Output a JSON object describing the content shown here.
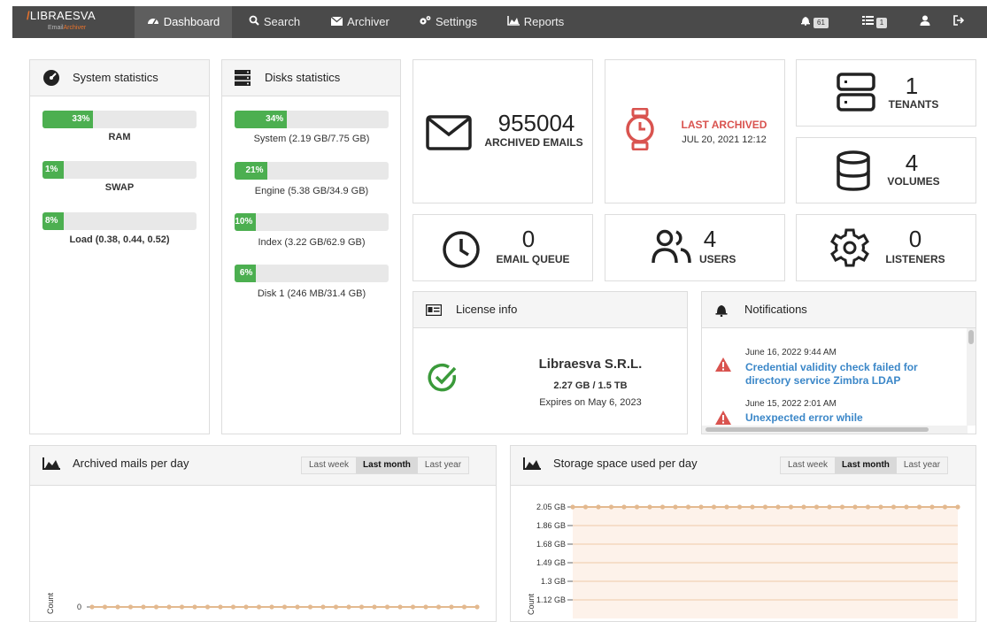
{
  "colors": {
    "accent_green": "#4caf50",
    "link_blue": "#3b87c8",
    "alert_red": "#d9534f",
    "brand_orange": "#e8722b",
    "chart_line": "#e3b98f",
    "chart_area": "#fdf2ea"
  },
  "brand": {
    "name": "LIBRAESVA",
    "sub_left": "Email",
    "sub_right": "Archiver"
  },
  "nav": {
    "items": [
      {
        "label": "Dashboard",
        "icon": "dashboard-icon"
      },
      {
        "label": "Search",
        "icon": "search-icon"
      },
      {
        "label": "Archiver",
        "icon": "envelope-icon"
      },
      {
        "label": "Settings",
        "icon": "gears-icon"
      },
      {
        "label": "Reports",
        "icon": "area-chart-icon"
      }
    ],
    "notifications_count": "61",
    "tasks_count": "1"
  },
  "system_stats": {
    "title": "System statistics",
    "bars": [
      {
        "pct_text": "33%",
        "fill": 0.33,
        "label": "RAM"
      },
      {
        "pct_text": "1%",
        "fill": 0.01,
        "label": "SWAP"
      },
      {
        "pct_text": "8%",
        "fill": 0.08,
        "label": "Load (0.38, 0.44, 0.52)"
      }
    ]
  },
  "disk_stats": {
    "title": "Disks statistics",
    "bars": [
      {
        "pct_text": "34%",
        "fill": 0.34,
        "label": "System (2.19 GB/7.75 GB)"
      },
      {
        "pct_text": "21%",
        "fill": 0.21,
        "label": "Engine (5.38 GB/34.9 GB)"
      },
      {
        "pct_text": "10%",
        "fill": 0.1,
        "label": "Index (3.22 GB/62.9 GB)"
      },
      {
        "pct_text": "6%",
        "fill": 0.06,
        "label": "Disk 1 (246 MB/31.4 GB)"
      }
    ]
  },
  "cards": {
    "archived": {
      "value": "955004",
      "label": "ARCHIVED EMAILS"
    },
    "last_archived": {
      "label": "LAST ARCHIVED",
      "value": "JUL 20, 2021 12:12"
    },
    "tenants": {
      "value": "1",
      "label": "TENANTS"
    },
    "volumes": {
      "value": "4",
      "label": "VOLUMES"
    },
    "queue": {
      "value": "0",
      "label": "EMAIL QUEUE"
    },
    "users": {
      "value": "4",
      "label": "USERS"
    },
    "listeners": {
      "value": "0",
      "label": "LISTENERS"
    }
  },
  "license": {
    "title": "License info",
    "company": "Libraesva S.R.L.",
    "usage": "2.27 GB / 1.5 TB",
    "expires": "Expires on May 6, 2023"
  },
  "notifications": {
    "title": "Notifications",
    "items": [
      {
        "date": "June 16, 2022 9:44 AM",
        "text_line1": "Credential validity check failed for",
        "text_line2": "directory service Zimbra LDAP"
      },
      {
        "date": "June 15, 2022 2:01 AM",
        "text_line1": "Unexpected error while",
        "text_line2": ""
      }
    ]
  },
  "range_options": [
    "Last week",
    "Last month",
    "Last year"
  ],
  "range_selected": "Last month",
  "chart_data": [
    {
      "type": "line",
      "title": "Archived mails per day",
      "ylabel": "Count",
      "y_ticks": [
        "0"
      ],
      "series": [
        {
          "values": [
            0,
            0,
            0,
            0,
            0,
            0,
            0,
            0,
            0,
            0,
            0,
            0,
            0,
            0,
            0,
            0,
            0,
            0,
            0,
            0,
            0,
            0,
            0,
            0,
            0,
            0,
            0,
            0,
            0,
            0,
            0
          ]
        }
      ]
    },
    {
      "type": "area",
      "title": "Storage space used per day",
      "ylabel": "Count",
      "y_ticks": [
        "2.05 GB",
        "1.86 GB",
        "1.68 GB",
        "1.49 GB",
        "1.3 GB",
        "1.12 GB"
      ],
      "ylim": [
        1.12,
        2.05
      ],
      "series": [
        {
          "values": [
            2.05,
            2.05,
            2.05,
            2.05,
            2.05,
            2.05,
            2.05,
            2.05,
            2.05,
            2.05,
            2.05,
            2.05,
            2.05,
            2.05,
            2.05,
            2.05,
            2.05,
            2.05,
            2.05,
            2.05,
            2.05,
            2.05,
            2.05,
            2.05,
            2.05,
            2.05,
            2.05,
            2.05,
            2.05,
            2.05,
            2.05
          ]
        }
      ]
    }
  ]
}
